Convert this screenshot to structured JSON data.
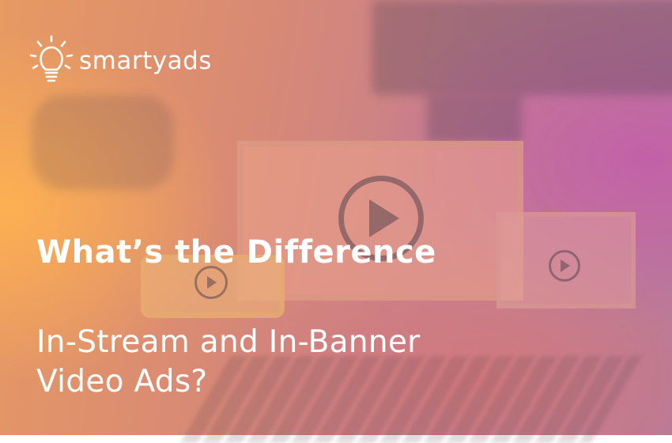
{
  "brand": {
    "name": "smartyads",
    "logo_icon": "lightbulb-icon",
    "text_color": "#ffffff"
  },
  "headline": "What’s the Difference",
  "subline": {
    "line1": "In-Stream and In-Banner",
    "line2": "Video Ads?"
  },
  "icons": {
    "main_play": "play-icon",
    "right_play": "play-icon",
    "phone_play": "play-icon"
  },
  "colors": {
    "warm": "#e79a62",
    "pink": "#c67f8e",
    "purple": "#b77b9a"
  }
}
